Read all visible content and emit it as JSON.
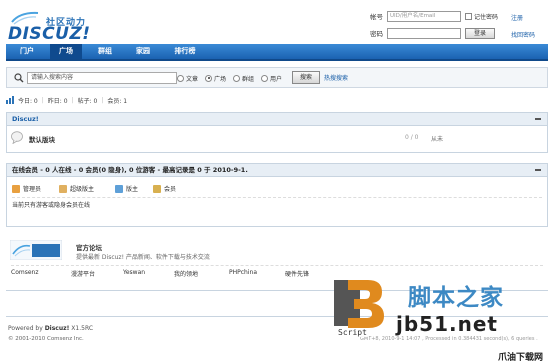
{
  "header": {
    "logo_slogan": "社区动力",
    "logo_text": "DISCUZ!"
  },
  "login": {
    "account_label": "帐号",
    "account_placeholder": "UID/用户名/Email",
    "remember_label": "记住密码",
    "register_link": "注册",
    "password_label": "密码",
    "login_button": "登录",
    "forgot_link": "找回密码"
  },
  "nav": {
    "items": [
      {
        "label": "门户",
        "active": false
      },
      {
        "label": "广场",
        "active": true
      },
      {
        "label": "群组",
        "active": false
      },
      {
        "label": "家园",
        "active": false
      },
      {
        "label": "排行榜",
        "active": false
      }
    ]
  },
  "search": {
    "input_value": "请输入搜索内容",
    "options": [
      {
        "label": "文章",
        "checked": false
      },
      {
        "label": "广场",
        "checked": true
      },
      {
        "label": "群组",
        "checked": false
      },
      {
        "label": "用户",
        "checked": false
      }
    ],
    "button_label": "搜索",
    "hot_link": "热搜搜索"
  },
  "stats": {
    "today": "今日: 0",
    "yesterday": "昨日: 0",
    "posts": "帖子: 0",
    "members": "会员: 1"
  },
  "forum_panel": {
    "title": "Discuz!",
    "forum_name": "默认版块",
    "count": "0 / 0",
    "last_post": "从未"
  },
  "online_panel": {
    "title": "在线会员 - 0 人在线 - 0 会员(0 隐身), 0 位游客 - 最高记录是 0 于 2010-9-1.",
    "legend": [
      {
        "label": "管理员",
        "color": "#e8a040"
      },
      {
        "label": "超级版主",
        "color": "#e0b060"
      },
      {
        "label": "版主",
        "color": "#5ea0d8"
      },
      {
        "label": "会员",
        "color": "#d8b050"
      }
    ],
    "online_text": "当前只有游客或隐身会员在线"
  },
  "links_panel": {
    "site_title": "官方论坛",
    "site_desc": "提供最新 Discuz! 产品新闻、软件下载与技术交流",
    "links": [
      "Comsenz",
      "漫游平台",
      "Yeswan",
      "我的领地",
      "PHPchina",
      "硬件先锋"
    ]
  },
  "footer": {
    "powered_prefix": "Powered by",
    "powered_product": "Discuz!",
    "powered_version": "X1.5RC",
    "copyright": "© 2001-2010 Comsenz Inc.",
    "right_text": "GMT+8, 2010-9-1 14:07 , Processed in 0.384431 second(s), 6 queries ."
  },
  "watermark": {
    "cn_text": "脚本之家",
    "url_text": "jb51.net",
    "script_label": "Script",
    "download_text": "爪油下载网"
  },
  "colors": {
    "nav_bg": "#1b62b1",
    "link_blue": "#1a5fa8",
    "panel_head": "#e7eef5"
  }
}
